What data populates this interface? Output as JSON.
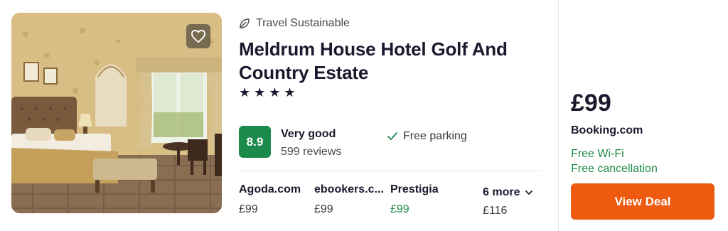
{
  "hotel": {
    "badge_label": "Travel Sustainable",
    "badge_icon": "leaf-icon",
    "name": "Meldrum House Hotel Golf And Country Estate",
    "stars": 4,
    "star_glyph": "★",
    "score": "8.9",
    "rating_word": "Very good",
    "reviews": "599 reviews",
    "amenity": "Free parking",
    "amenity_icon": "checkmark-icon",
    "favorite_icon": "heart-icon"
  },
  "providers": [
    {
      "name": "Agoda.com",
      "price": "£99"
    },
    {
      "name": "ebookers.c...",
      "price": "£99"
    },
    {
      "name": "Prestigia",
      "price": "£99",
      "highlight": true
    }
  ],
  "more": {
    "label": "6 more",
    "price": "£116",
    "icon": "chevron-down-icon"
  },
  "deal": {
    "price": "£99",
    "site": "Booking.com",
    "perks": [
      "Free Wi-Fi",
      "Free cancellation"
    ],
    "button_label": "View Deal"
  },
  "colors": {
    "score_green": "#1b8a4a",
    "deal_orange": "#ee5a10",
    "perk_green": "#1b8a4a"
  }
}
